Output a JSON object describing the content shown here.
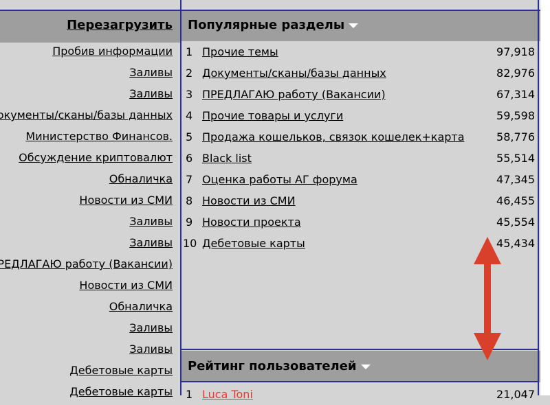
{
  "left": {
    "reload_label": "Перезагрузить",
    "links": [
      "Пробив информации",
      "Заливы",
      "Заливы",
      "Документы/сканы/базы данных",
      "Министерство Финансов.",
      "Обсуждение криптовалют",
      "Обналичка",
      "Новости из СМИ",
      "Заливы",
      "Заливы",
      "ПРЕДЛАГАЮ работу (Вакансии)",
      "Новости из СМИ",
      "Обналичка",
      "Заливы",
      "Заливы",
      "Дебетовые карты",
      "Дебетовые карты"
    ]
  },
  "popular": {
    "title": "Популярные разделы",
    "rows": [
      {
        "num": "1",
        "name": "Прочие темы",
        "value": "97,918"
      },
      {
        "num": "2",
        "name": "Документы/сканы/базы данных",
        "value": "82,976"
      },
      {
        "num": "3",
        "name": "ПРЕДЛАГАЮ работу (Вакансии)",
        "value": "67,314"
      },
      {
        "num": "4",
        "name": "Прочие товары и услуги",
        "value": "59,598"
      },
      {
        "num": "5",
        "name": "Продажа кошельков, связок кошелек+карта",
        "value": "58,776"
      },
      {
        "num": "6",
        "name": "Black list",
        "value": "55,514"
      },
      {
        "num": "7",
        "name": "Оценка работы АГ форума",
        "value": "47,345"
      },
      {
        "num": "8",
        "name": "Новости из СМИ",
        "value": "46,455"
      },
      {
        "num": "9",
        "name": "Новости проекта",
        "value": "45,554"
      },
      {
        "num": "10",
        "name": "Дебетовые карты",
        "value": "45,434"
      }
    ]
  },
  "rating": {
    "title": "Рейтинг пользователей",
    "rows": [
      {
        "num": "1",
        "name": "Luca Toni",
        "value": "21,047"
      }
    ]
  },
  "colors": {
    "header_bg": "#9e9e9e",
    "panel_bg": "#d4d4d4",
    "border": "#2b2f8f",
    "arrow": "#d9402c",
    "user_link": "#e8382e"
  }
}
